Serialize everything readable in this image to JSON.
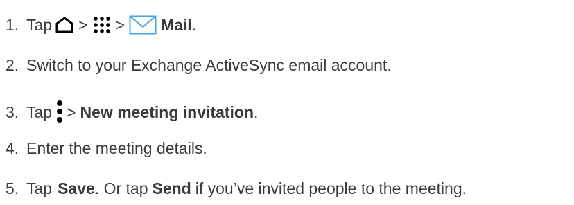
{
  "steps": [
    {
      "number": "1.",
      "tap": "Tap",
      "sep1": ">",
      "sep2": ">",
      "bold": "Mail",
      "end": ".",
      "icons": [
        "home-icon",
        "apps-grid-icon",
        "mail-envelope-icon"
      ]
    },
    {
      "number": "2.",
      "text": "Switch to your Exchange ActiveSync email account."
    },
    {
      "number": "3.",
      "tap": "Tap",
      "sep": ">",
      "bold": "New meeting invitation",
      "end": ".",
      "icons": [
        "more-vertical-icon"
      ]
    },
    {
      "number": "4.",
      "text": "Enter the meeting details."
    },
    {
      "number": "5.",
      "tap": "Tap",
      "bold1": "Save",
      "mid": ". Or tap",
      "bold2": "Send",
      "end": "if you’ve invited people to the meeting."
    }
  ],
  "colors": {
    "text": "#3a3a3a",
    "icon": "#000000",
    "mail_icon": "#4aa3df"
  }
}
